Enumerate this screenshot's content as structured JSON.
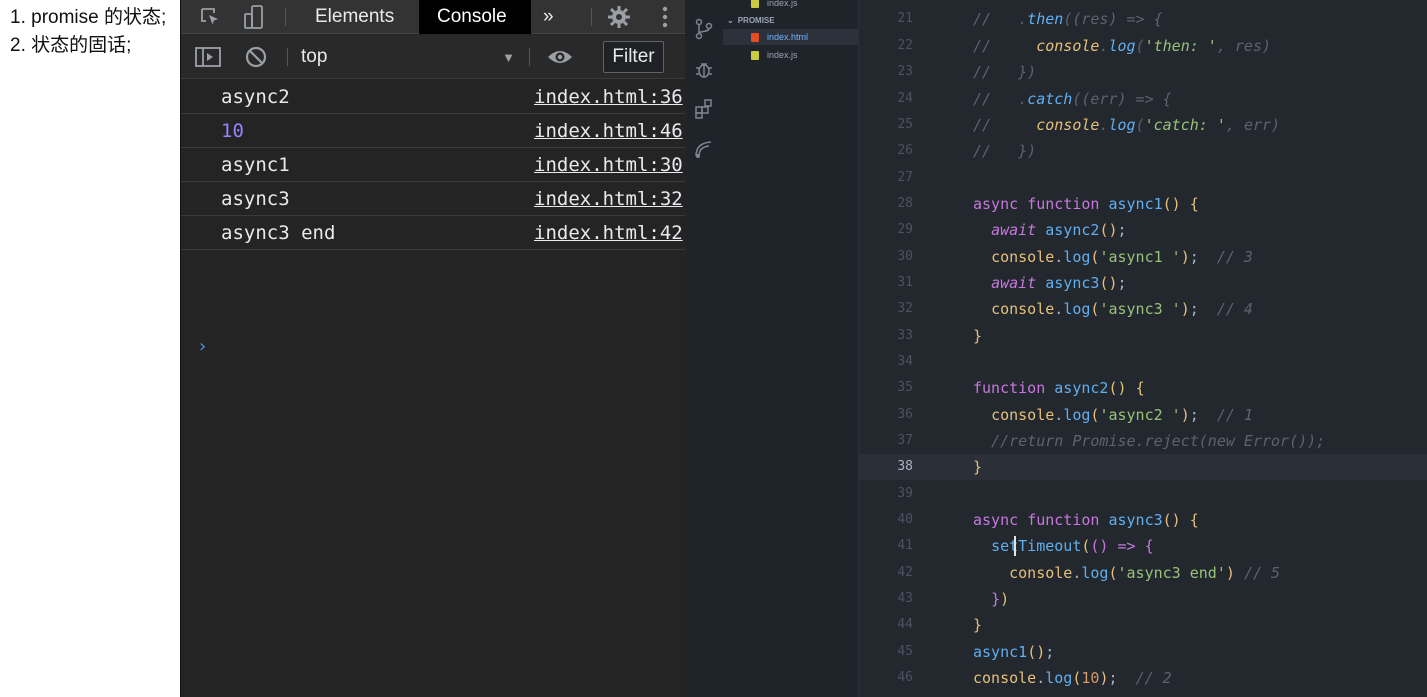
{
  "notes": {
    "text": "1. promise 的状态; 2. 状态的固话;"
  },
  "devtools": {
    "tabs": [
      "Elements",
      "Console"
    ],
    "active_tab": "Console",
    "more_tabs_label": "»",
    "context": "top",
    "filter_label": "Filter",
    "logs": [
      {
        "message": "async2",
        "source": "index.html:36"
      },
      {
        "message": "10",
        "source": "index.html:46"
      },
      {
        "message": "async1",
        "source": "index.html:30"
      },
      {
        "message": "async3",
        "source": "index.html:32"
      },
      {
        "message": "async3 end",
        "source": "index.html:42"
      }
    ],
    "prompt": "›"
  },
  "explorer": {
    "folder": "PROMISE",
    "files": [
      "index.js",
      "index.html",
      "index.js"
    ],
    "active_file": "index.html"
  },
  "editor": {
    "lines": [
      {
        "no": "21",
        "text": "//   .then((res) => {"
      },
      {
        "no": "22",
        "text": "//     console.log('then: ', res)"
      },
      {
        "no": "23",
        "text": "//   })"
      },
      {
        "no": "24",
        "text": "//   .catch((err) => {"
      },
      {
        "no": "25",
        "text": "//     console.log('catch: ', err)"
      },
      {
        "no": "26",
        "text": "//   })"
      },
      {
        "no": "27",
        "text": ""
      },
      {
        "no": "28",
        "text": "async function async1() {"
      },
      {
        "no": "29",
        "text": "  await async2();"
      },
      {
        "no": "30",
        "text": "  console.log('async1 ');  // 3"
      },
      {
        "no": "31",
        "text": "  await async3();"
      },
      {
        "no": "32",
        "text": "  console.log('async3 ');  // 4"
      },
      {
        "no": "33",
        "text": "}"
      },
      {
        "no": "34",
        "text": ""
      },
      {
        "no": "35",
        "text": "function async2() {"
      },
      {
        "no": "36",
        "text": "  console.log('async2 ');  // 1"
      },
      {
        "no": "37",
        "text": "  //return Promise.reject(new Error());"
      },
      {
        "no": "38",
        "text": "}"
      },
      {
        "no": "39",
        "text": ""
      },
      {
        "no": "40",
        "text": "async function async3() {"
      },
      {
        "no": "41",
        "text": "  setTimeout(() => {"
      },
      {
        "no": "42",
        "text": "    console.log('async3 end') // 5"
      },
      {
        "no": "43",
        "text": "  })"
      },
      {
        "no": "44",
        "text": "}"
      },
      {
        "no": "45",
        "text": "async1();"
      },
      {
        "no": "46",
        "text": "console.log(10);  // 2"
      }
    ],
    "current_line": "38"
  },
  "colors": {
    "devtools_bg": "#242424",
    "editor_bg": "#23272e",
    "keyword": "#c678dd",
    "function": "#61afef",
    "string": "#98c379",
    "comment": "#5c6370",
    "object": "#e5c07b",
    "number_console": "#9980ff"
  }
}
